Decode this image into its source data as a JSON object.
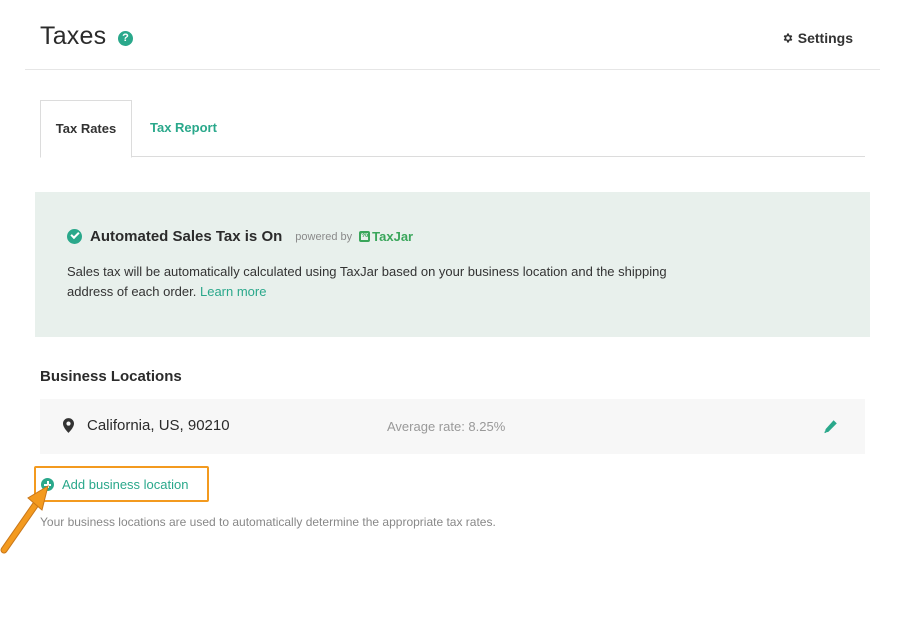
{
  "header": {
    "title": "Taxes",
    "help_icon_glyph": "?",
    "settings_label": "Settings"
  },
  "tabs": [
    {
      "label": "Tax Rates",
      "active": true
    },
    {
      "label": "Tax Report",
      "active": false
    }
  ],
  "banner": {
    "title": "Automated Sales Tax is On",
    "powered_by": "powered by",
    "brand": "TaxJar",
    "text": "Sales tax will be automatically calculated using TaxJar based on your business location and the shipping address of each order.",
    "learn_more": "Learn more"
  },
  "locations": {
    "section_title": "Business Locations",
    "items": [
      {
        "name": "California, US, 90210",
        "average_rate": "Average rate: 8.25%"
      }
    ],
    "add_label": "Add business location",
    "help_text": "Your business locations are used to automatically determine the appropriate tax rates."
  },
  "colors": {
    "accent": "#2aa88b",
    "banner_bg": "#e8f0ec",
    "highlight": "#f39a1f"
  }
}
